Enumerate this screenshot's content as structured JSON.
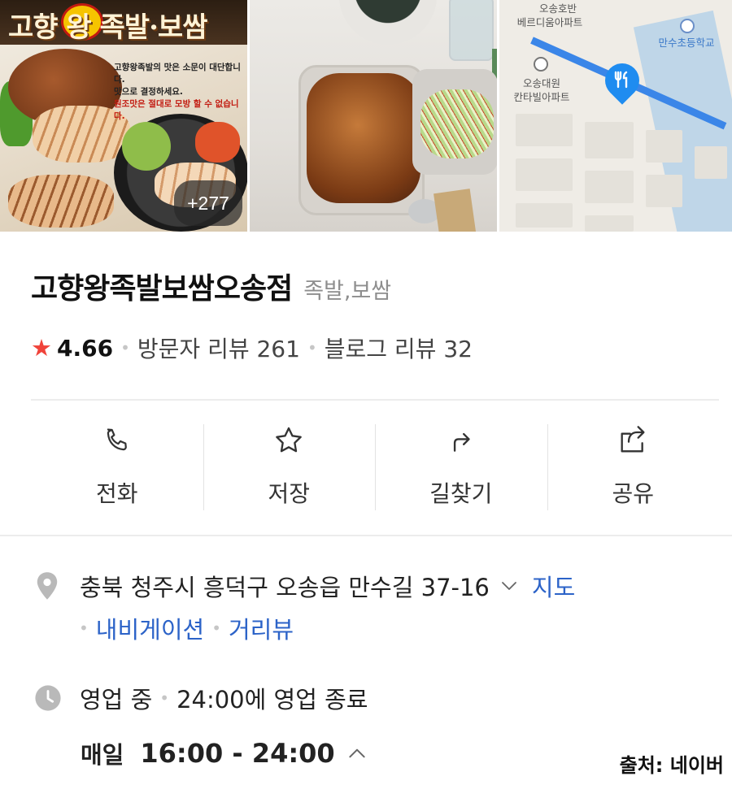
{
  "photos": {
    "banner_title": "고향 왕 족발·보쌈",
    "ad_lines": [
      "고향왕족발의 맛은 소문이 대단합니다.",
      "맛으로 결정하세요.",
      "원조맛은 절대로 모방 할 수 없습니다."
    ],
    "photo_count": "+277"
  },
  "map": {
    "labels": [
      "오송호반",
      "베르디움아파트",
      "오송대원",
      "칸타빌아파트",
      "만수초등학교"
    ],
    "route_color": "#3b86e8",
    "pin_color": "#1f8cf0"
  },
  "place": {
    "name": "고향왕족발보쌈오송점",
    "category": "족발,보쌈"
  },
  "rating": {
    "score": "4.66",
    "visitor_reviews": "방문자 리뷰 261",
    "blog_reviews": "블로그 리뷰 32",
    "star_color": "#f0433a"
  },
  "actions": [
    {
      "label": "전화",
      "icon": "phone-icon"
    },
    {
      "label": "저장",
      "icon": "star-icon"
    },
    {
      "label": "길찾기",
      "icon": "directions-icon"
    },
    {
      "label": "공유",
      "icon": "share-icon"
    }
  ],
  "address": {
    "text": "충북 청주시 흥덕구 오송읍 만수길 37-16",
    "map_link": "지도",
    "navigation_link": "내비게이션",
    "street_view_link": "거리뷰",
    "link_color": "#2c63c8"
  },
  "hours": {
    "status": "영업 중",
    "closing": "24:00에 영업 종료",
    "daily_label": "매일",
    "daily_time": "16:00 - 24:00"
  },
  "source": "출처: 네이버"
}
